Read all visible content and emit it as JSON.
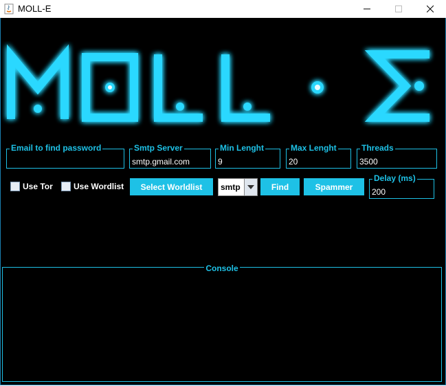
{
  "window": {
    "title": "MOLL-E",
    "app_icon": "java-icon"
  },
  "colors": {
    "accent": "#1ec1e6",
    "background": "#000000",
    "logo_glow": "#29d8ff"
  },
  "logo": {
    "text": "MOLL-E"
  },
  "fields": {
    "email": {
      "label": "Email to find password",
      "value": ""
    },
    "smtp_server": {
      "label": "Smtp Server",
      "value": "smtp.gmail.com"
    },
    "min_length": {
      "label": "Min Lenght",
      "value": "9"
    },
    "max_length": {
      "label": "Max Lenght",
      "value": "20"
    },
    "threads": {
      "label": "Threads",
      "value": "3500"
    },
    "delay": {
      "label": "Delay (ms)",
      "value": "200"
    }
  },
  "options": {
    "use_tor": "Use Tor",
    "use_wordlist": "Use Wordlist"
  },
  "buttons": {
    "select_wordlist": "Select Worldlist",
    "find": "Find",
    "spammer": "Spammer"
  },
  "protocol_select": {
    "value": "smtp"
  },
  "console": {
    "label": "Console"
  }
}
